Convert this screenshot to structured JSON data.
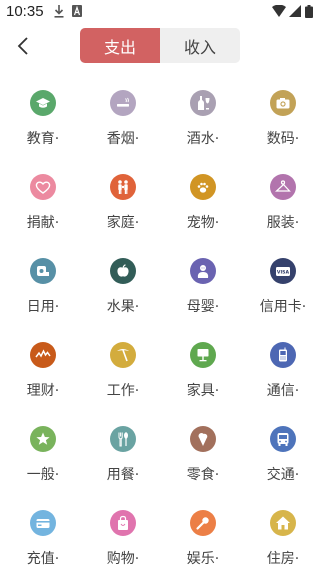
{
  "status_bar": {
    "time": "10:35"
  },
  "tabs": [
    {
      "label": "支出",
      "active": true
    },
    {
      "label": "收入",
      "active": false
    }
  ],
  "categories": [
    {
      "label": "教育·",
      "icon": "graduation-cap-icon",
      "color": "#5aa86b"
    },
    {
      "label": "香烟·",
      "icon": "cigarette-icon",
      "color": "#b3a5c0"
    },
    {
      "label": "酒水·",
      "icon": "wine-bottle-icon",
      "color": "#a9a0b2"
    },
    {
      "label": "数码·",
      "icon": "camera-icon",
      "color": "#c2a257"
    },
    {
      "label": "捐献·",
      "icon": "heart-icon",
      "color": "#ec8aa0"
    },
    {
      "label": "家庭·",
      "icon": "family-icon",
      "color": "#e0633a"
    },
    {
      "label": "宠物·",
      "icon": "paw-icon",
      "color": "#d19524"
    },
    {
      "label": "服装·",
      "icon": "hanger-icon",
      "color": "#b274ad"
    },
    {
      "label": "日用·",
      "icon": "toilet-paper-icon",
      "color": "#5790a6"
    },
    {
      "label": "水果·",
      "icon": "apple-icon",
      "color": "#325d58"
    },
    {
      "label": "母婴·",
      "icon": "baby-icon",
      "color": "#6a63b1"
    },
    {
      "label": "信用卡·",
      "icon": "visa-card-icon",
      "color": "#35416c"
    },
    {
      "label": "理财·",
      "icon": "stock-chart-icon",
      "color": "#c85a1a"
    },
    {
      "label": "工作·",
      "icon": "pickaxe-icon",
      "color": "#d3ac3d"
    },
    {
      "label": "家具·",
      "icon": "lamp-icon",
      "color": "#5fa84f"
    },
    {
      "label": "通信·",
      "icon": "phone-icon",
      "color": "#4d67b3"
    },
    {
      "label": "一般·",
      "icon": "star-icon",
      "color": "#79b35c"
    },
    {
      "label": "用餐·",
      "icon": "fork-spoon-icon",
      "color": "#6aa3a2"
    },
    {
      "label": "零食·",
      "icon": "ice-cream-icon",
      "color": "#a2705c"
    },
    {
      "label": "交通·",
      "icon": "bus-icon",
      "color": "#4e74bb"
    },
    {
      "label": "充值·",
      "icon": "wallet-card-icon",
      "color": "#73b4df"
    },
    {
      "label": "购物·",
      "icon": "shopping-bag-icon",
      "color": "#e074ae"
    },
    {
      "label": "娱乐·",
      "icon": "microphone-icon",
      "color": "#ec7f46"
    },
    {
      "label": "住房·",
      "icon": "house-icon",
      "color": "#d7b54b"
    }
  ],
  "colors": {
    "accent": "#d26262",
    "tab_bg": "#efefef"
  }
}
